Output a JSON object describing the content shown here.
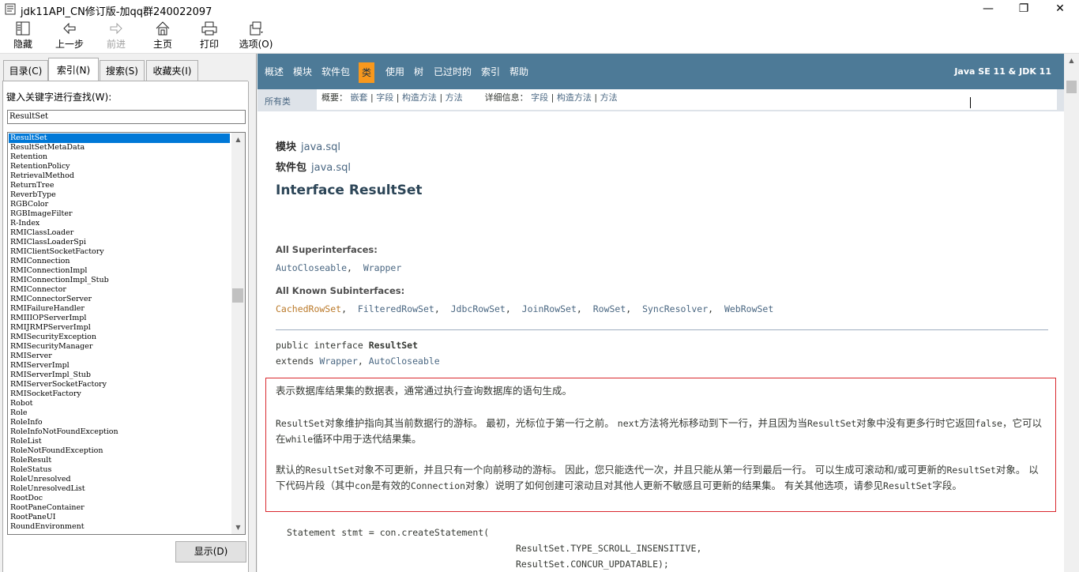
{
  "window": {
    "title": "jdk11API_CN修订版-加qq群240022097",
    "minimize": "—",
    "maximize": "❐",
    "close": "✕"
  },
  "toolbar": {
    "hide": "隐藏",
    "back": "上一步",
    "forward": "前进",
    "home": "主页",
    "print": "打印",
    "options": "选项(O)"
  },
  "tabs": {
    "contents": "目录(C)",
    "index": "索引(N)",
    "search": "搜索(S)",
    "favorites": "收藏夹(I)"
  },
  "index": {
    "label": "键入关键字进行查找(W):",
    "input_value": "ResultSet",
    "selected": "ResultSet",
    "items": [
      "ResultSet",
      "ResultSetMetaData",
      "Retention",
      "RetentionPolicy",
      "RetrievalMethod",
      "ReturnTree",
      "ReverbType",
      "RGBColor",
      "RGBImageFilter",
      "R-Index",
      "RMIClassLoader",
      "RMIClassLoaderSpi",
      "RMIClientSocketFactory",
      "RMIConnection",
      "RMIConnectionImpl",
      "RMIConnectionImpl_Stub",
      "RMIConnector",
      "RMIConnectorServer",
      "RMIFailureHandler",
      "RMIIIOPServerImpl",
      "RMIJRMPServerImpl",
      "RMISecurityException",
      "RMISecurityManager",
      "RMIServer",
      "RMIServerImpl",
      "RMIServerImpl_Stub",
      "RMIServerSocketFactory",
      "RMISocketFactory",
      "Robot",
      "Role",
      "RoleInfo",
      "RoleInfoNotFoundException",
      "RoleList",
      "RoleNotFoundException",
      "RoleResult",
      "RoleStatus",
      "RoleUnresolved",
      "RoleUnresolvedList",
      "RootDoc",
      "RootPaneContainer",
      "RootPaneUI",
      "RoundEnvironment"
    ],
    "show_button": "显示(D)"
  },
  "nav": {
    "items": [
      "概述",
      "模块",
      "软件包",
      "类",
      "使用",
      "树",
      "已过时的",
      "索引",
      "帮助"
    ],
    "active": "类",
    "about": "Java SE 11 & JDK 11"
  },
  "subnav": {
    "all_classes": "所有类",
    "summary_label": "概要：",
    "summary_nested": "嵌套",
    "summary_field": "字段",
    "summary_constr": "构造方法",
    "summary_method": "方法",
    "detail_label": "详细信息：",
    "detail_field": "字段",
    "detail_constr": "构造方法",
    "detail_method": "方法",
    "bar": "|"
  },
  "doc": {
    "module_label": "模块",
    "module_value": "java.sql",
    "package_label": "软件包",
    "package_value": "java.sql",
    "title": "Interface ResultSet",
    "superinterfaces_label": "All Superinterfaces:",
    "superinterfaces": [
      "AutoCloseable",
      "Wrapper"
    ],
    "subinterfaces_label": "All Known Subinterfaces:",
    "subinterfaces": [
      "CachedRowSet",
      "FilteredRowSet",
      "JdbcRowSet",
      "JoinRowSet",
      "RowSet",
      "SyncResolver",
      "WebRowSet"
    ],
    "list_sep": ",",
    "sig_line1_prefix": "public interface ",
    "sig_line1_name": "ResultSet",
    "sig_line2_prefix": "extends ",
    "sig_line2_a": "Wrapper",
    "sig_line2_sep": ", ",
    "sig_line2_b": "AutoCloseable",
    "desc_p1": "表示数据库结果集的数据表，通常通过执行查询数据库的语句生成。",
    "desc_p2_a": "ResultSet",
    "desc_p2_b": "对象维护指向其当前数据行的游标。 最初，光标位于第一行之前。 ",
    "desc_p2_c": "next",
    "desc_p2_d": "方法将光标移动到下一行，并且因为当",
    "desc_p2_e": "ResultSet",
    "desc_p2_f": "对象中没有更多行时它返回",
    "desc_p2_g": "false",
    "desc_p2_h": "，它可以在",
    "desc_p2_i": "while",
    "desc_p2_j": "循环中用于迭代结果集。",
    "desc_p3_a": "默认的",
    "desc_p3_b": "ResultSet",
    "desc_p3_c": "对象不可更新，并且只有一个向前移动的游标。 因此，您只能迭代一次，并且只能从第一行到最后一行。 可以生成可滚动和/或可更新的",
    "desc_p3_d": "ResultSet",
    "desc_p3_e": "对象。 以下代码片段（其中",
    "desc_p3_f": "con",
    "desc_p3_g": "是有效的",
    "desc_p3_h": "Connection",
    "desc_p3_i": "对象）说明了如何创建可滚动且对其他人更新不敏感且可更新的结果集。 有关其他选项，请参见",
    "desc_p3_j": "ResultSet",
    "desc_p3_k": "字段。",
    "code_line1": "Statement stmt = con.createStatement(",
    "code_line2": "ResultSet.TYPE_SCROLL_INSENSITIVE,",
    "code_line3": "ResultSet.CONCUR_UPDATABLE);"
  },
  "colors": {
    "navbar": "#4d7a97",
    "nav_active": "#f8981d",
    "subnav": "#dee3e9",
    "link": "#4a6782",
    "highlight_border": "#d9282e",
    "selection": "#0078d7"
  }
}
